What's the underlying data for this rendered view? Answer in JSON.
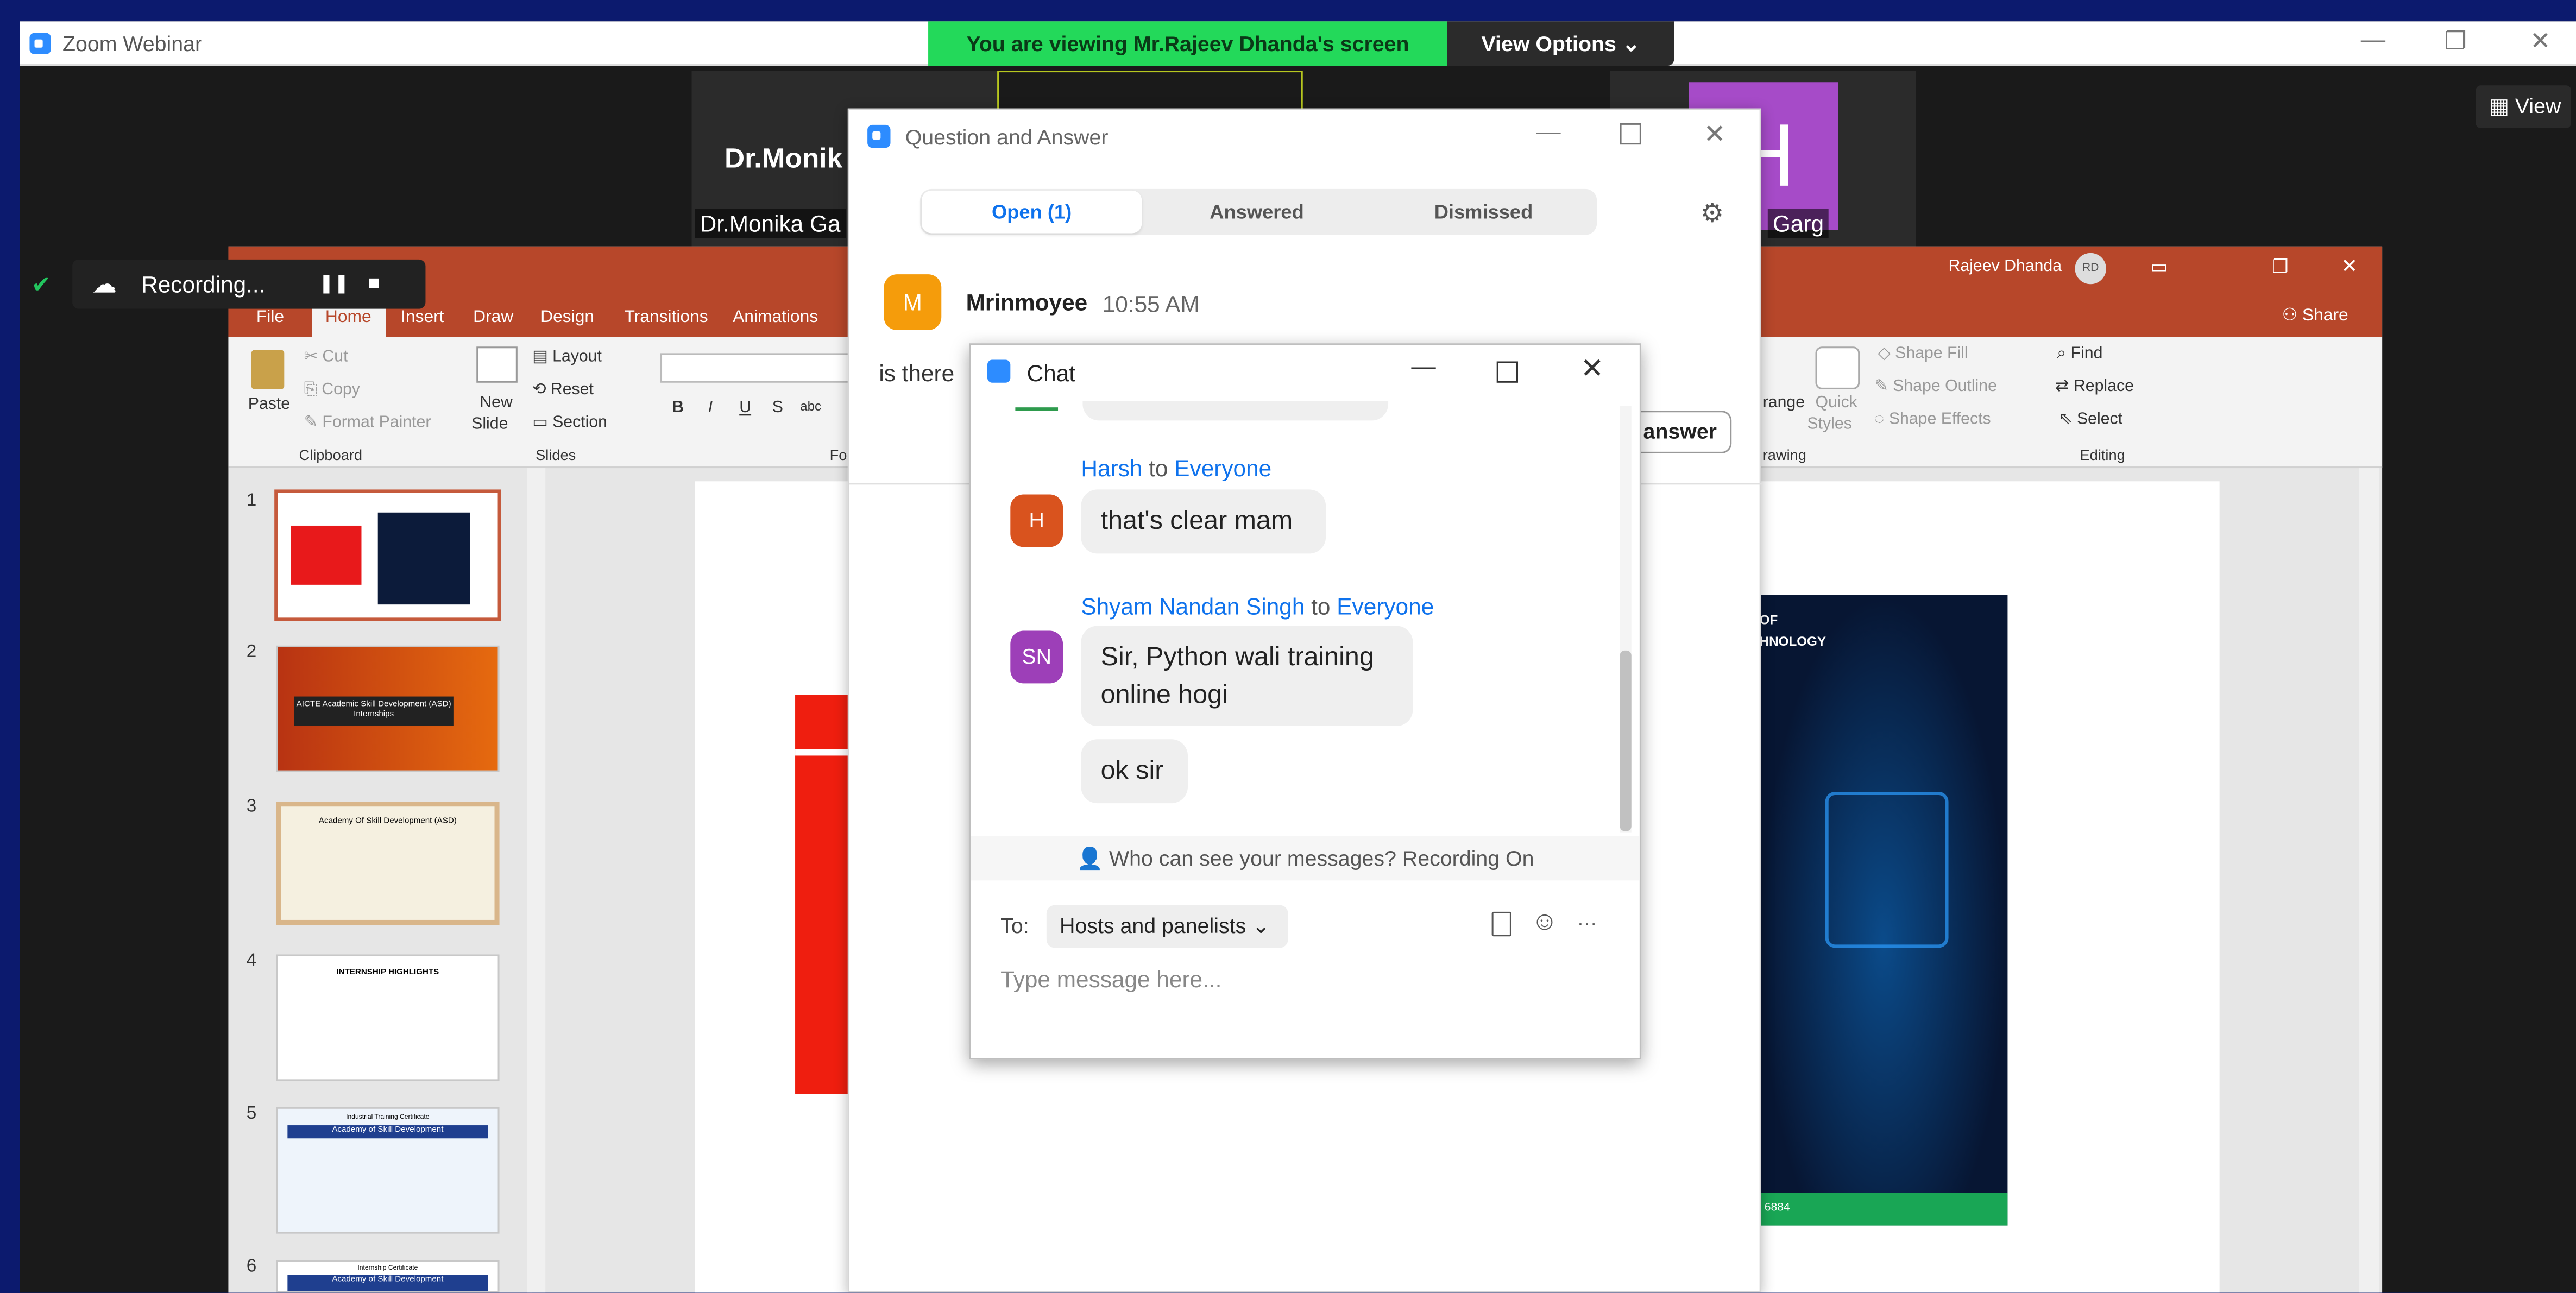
{
  "zoom": {
    "title": "Zoom Webinar",
    "banner": "You are viewing Mr.Rajeev Dhanda's screen",
    "view_options": "View Options ⌄",
    "view_btn": "View",
    "min": "—",
    "restore": "❐",
    "close": "✕"
  },
  "participants": {
    "tile1_name_big": "Dr.Monik",
    "tile1_name": "Dr.Monika Ga",
    "tile3_letter": "H",
    "tile3_name": "Garg"
  },
  "recording": {
    "label": "Recording...",
    "pause": "❚❚",
    "stop": "■"
  },
  "ppt": {
    "user": "Rajeev Dhanda",
    "initials": "RD",
    "share": "Share",
    "tabs": [
      "File",
      "Home",
      "Insert",
      "Draw",
      "Design",
      "Transitions",
      "Animations"
    ],
    "clipboard": {
      "paste": "Paste",
      "cut": "Cut",
      "copy": "Copy",
      "format_painter": "Format Painter",
      "label": "Clipboard"
    },
    "slides_group": {
      "new": "New",
      "slide": "Slide",
      "layout": "Layout",
      "reset": "Reset",
      "section": "Section",
      "label": "Slides"
    },
    "font_btns": [
      "B",
      "I",
      "U",
      "S",
      "abc"
    ],
    "font_label": "Fo",
    "drawing": {
      "arrange": "range",
      "quick": "Quick",
      "styles": "Styles",
      "shape_fill": "Shape Fill",
      "shape_outline": "Shape Outline",
      "shape_effects": "Shape Effects",
      "label": "rawing"
    },
    "editing": {
      "find": "Find",
      "replace": "Replace",
      "select": "Select",
      "label": "Editing"
    },
    "thumbs": [
      "1",
      "2",
      "3",
      "4",
      "5",
      "6"
    ],
    "thumb_texts": {
      "t2": "AICTE Academic Skill Development (ASD) Internships",
      "t3": "Academy Of Skill Development (ASD)",
      "t4": "INTERNSHIP HIGHLIGHTS",
      "t5": "Industrial Training Certificate",
      "t5b": "Academy of Skill Development",
      "t6": "Internship Certificate",
      "t6b": "Academy of Skill Development"
    },
    "slide_text": {
      "of": "OF",
      "hnology": "HNOLOGY",
      "code": "6884"
    }
  },
  "qa": {
    "title": "Question and Answer",
    "tabs": {
      "open": "Open (1)",
      "answered": "Answered",
      "dismissed": "Dismissed"
    },
    "asker_initial": "M",
    "asker": "Mrinmoyee",
    "time": "10:55 AM",
    "question": "is there",
    "answer_btn": "answer"
  },
  "chat": {
    "title": "Chat",
    "messages": [
      {
        "initials": "H",
        "name": "Harsh",
        "to": "to",
        "target": "Everyone",
        "lines": [
          "that's clear mam"
        ]
      },
      {
        "initials": "SN",
        "name": "Shyam Nandan Singh",
        "to": "to",
        "target": "Everyone",
        "lines": [
          "Sir, Python wali training",
          "online hogi"
        ],
        "extra": "ok sir"
      }
    ],
    "notice": "Who can see your messages? Recording On",
    "to_label": "To:",
    "recipient": "Hosts and panelists",
    "placeholder": "Type message here...",
    "more": "···"
  },
  "colors": {
    "zoom_blue": "#0e72ed",
    "ppt_red": "#b7472a",
    "green": "#23d95a"
  }
}
